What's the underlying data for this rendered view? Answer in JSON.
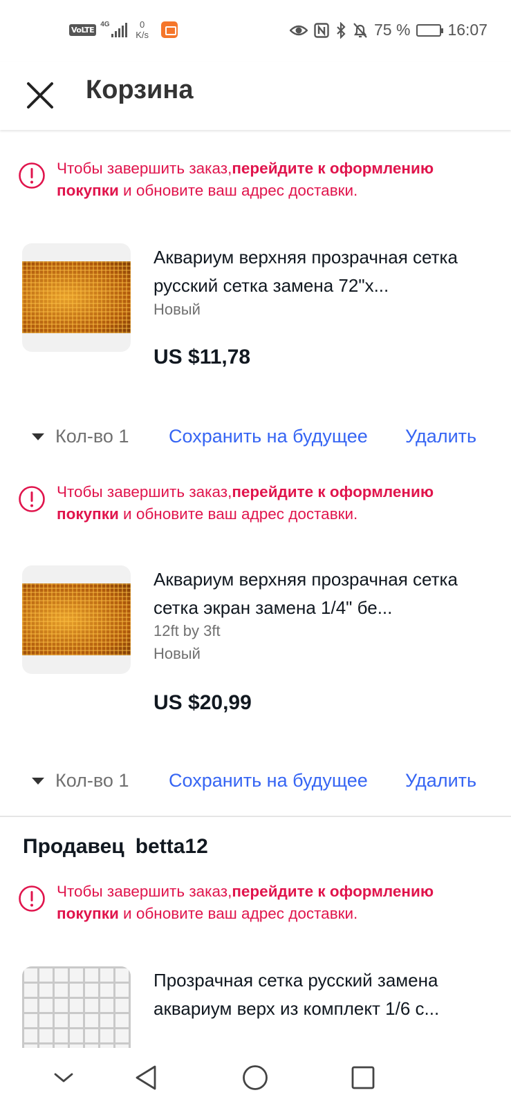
{
  "status_bar": {
    "volte": "VoLTE",
    "network": "4G",
    "speed_value": "0",
    "speed_unit": "K/s",
    "battery_text": "75 %",
    "battery_level": 0.75,
    "time": "16:07",
    "icons": [
      "eye-icon",
      "nfc-icon",
      "bluetooth-icon",
      "bell-off-icon",
      "battery-icon"
    ]
  },
  "header": {
    "title": "Корзина",
    "close_icon": "close-icon"
  },
  "warning": {
    "prefix": "Чтобы завершить заказ,",
    "link": "перейдите к оформлению покупки",
    "suffix": " и обновите ваш адрес доставки."
  },
  "items": [
    {
      "title": "Аквариум верхняя прозрачная сетка русский сетка замена 72\"x...",
      "variant": "",
      "condition": "Новый",
      "price": "US $11,78",
      "qty_label": "Кол-во 1",
      "save_label": "Сохранить на будущее",
      "delete_label": "Удалить"
    },
    {
      "title": "Аквариум верхняя прозрачная сетка сетка экран замена 1/4\" бе...",
      "variant": "12ft by 3ft",
      "condition": "Новый",
      "price": "US $20,99",
      "qty_label": "Кол-во 1",
      "save_label": "Сохранить на будущее",
      "delete_label": "Удалить"
    },
    {
      "title": "Прозрачная сетка русский замена аквариум верх из комплект 1/6 с..."
    }
  ],
  "seller": {
    "label": "Продавец",
    "name": "betta12"
  },
  "colors": {
    "warning": "#e0144c",
    "link": "#3665f3",
    "text": "#111820",
    "muted": "#707070"
  },
  "nav_bar": [
    "chevron-down-icon",
    "back-triangle-icon",
    "home-circle-icon",
    "recent-square-icon"
  ]
}
